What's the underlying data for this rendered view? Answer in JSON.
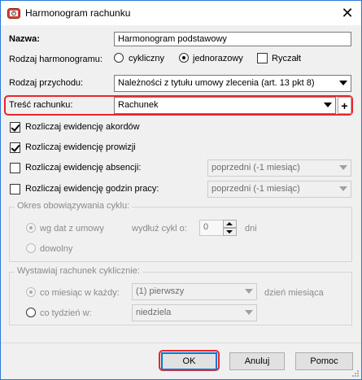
{
  "window": {
    "title": "Harmonogram rachunku",
    "close_glyph": "✕",
    "icon": "app-calendar-icon"
  },
  "form": {
    "name_label": "Nazwa:",
    "name_value": "Harmonogram podstawowy",
    "schedule_type_label": "Rodzaj harmonogramu:",
    "schedule_options": [
      "cykliczny",
      "jednorazowy"
    ],
    "schedule_selected": "jednorazowy",
    "ryczalt_label": "Ryczałt",
    "ryczalt_checked": false,
    "income_type_label": "Rodzaj przychodu:",
    "income_type_value": "Należności z tytułu umowy zlecenia (art. 13 pkt 8)",
    "bill_content_label": "Treść rachunku:",
    "bill_content_value": "Rachunek",
    "add_glyph": "+",
    "settle_accords_label": "Rozliczaj ewidencję akordów",
    "settle_accords_checked": true,
    "settle_commission_label": "Rozliczaj ewidencję prowizji",
    "settle_commission_checked": true,
    "settle_absence_label": "Rozliczaj ewidencję absencji:",
    "settle_absence_checked": false,
    "settle_absence_value": "poprzedni (-1 miesiąc)",
    "settle_hours_label": "Rozliczaj ewidencję godzin pracy:",
    "settle_hours_checked": false,
    "settle_hours_value": "poprzedni (-1 miesiąc)"
  },
  "cycle_period": {
    "title": "Okres obowiązywania cyklu:",
    "option_contract": "wg dat z umowy",
    "option_any": "dowolny",
    "extend_label": "wydłuż cykl o:",
    "extend_value": "0",
    "days_label": "dni"
  },
  "cyclic_bill": {
    "title": "Wystawiaj rachunek cyklicznie:",
    "monthly_label": "co miesiąc w każdy:",
    "monthly_value": "(1) pierwszy",
    "day_of_month_label": "dzień miesiąca",
    "weekly_label": "co tydzień w:",
    "weekly_value": "niedziela"
  },
  "buttons": {
    "ok": "OK",
    "cancel": "Anuluj",
    "help": "Pomoc"
  },
  "colors": {
    "highlight": "#e8262c",
    "accent": "#0078d7",
    "window_border": "#2b79d8"
  }
}
